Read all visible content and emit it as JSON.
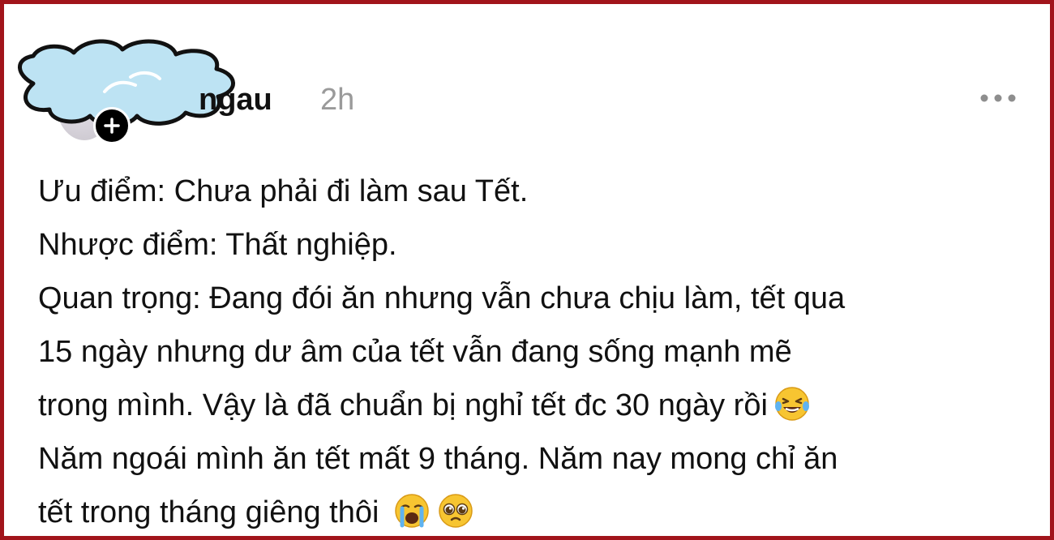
{
  "post": {
    "username": "ngau",
    "timestamp": "2h",
    "more_icon": "more-horizontal-icon",
    "follow_icon": "plus-icon",
    "lines": [
      "Ưu điểm: Chưa phải đi làm sau Tết.",
      "Nhược điểm: Thất nghiệp.",
      "Quan trọng: Đang đói ăn nhưng vẫn chưa chịu làm, tết qua",
      "15 ngày nhưng dư âm của tết vẫn đang sống mạnh mẽ",
      "trong mình. Vậy là đã chuẩn bị nghỉ tết đc 30 ngày rồi",
      "Năm ngoái mình ăn tết mất 9 tháng. Năm nay mong chỉ ăn",
      "tết trong tháng giêng thôi"
    ],
    "emojis": [
      "laughing-tears-emoji",
      "crying-emoji",
      "pleading-emoji"
    ]
  },
  "colors": {
    "frame": "#a1141b",
    "text": "#111111",
    "muted": "#9a9a9a",
    "cloud": "#bde3f3"
  }
}
